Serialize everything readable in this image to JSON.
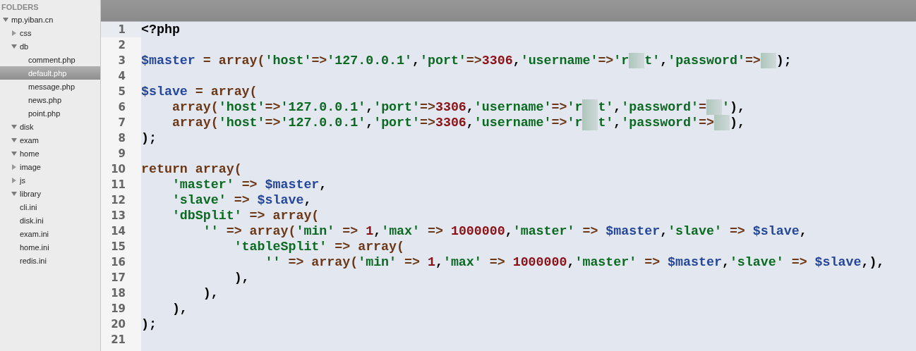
{
  "sidebar": {
    "header": "FOLDERS",
    "tree": [
      {
        "name": "mp.yiban.cn",
        "kind": "folder",
        "expanded": true,
        "selected": false,
        "children": [
          {
            "name": "css",
            "kind": "folder",
            "expanded": false,
            "selected": false
          },
          {
            "name": "db",
            "kind": "folder",
            "expanded": true,
            "selected": false,
            "children": [
              {
                "name": "comment.php",
                "kind": "file",
                "selected": false
              },
              {
                "name": "default.php",
                "kind": "file",
                "selected": true
              },
              {
                "name": "message.php",
                "kind": "file",
                "selected": false
              },
              {
                "name": "news.php",
                "kind": "file",
                "selected": false
              },
              {
                "name": "point.php",
                "kind": "file",
                "selected": false
              }
            ]
          },
          {
            "name": "disk",
            "kind": "folder",
            "expanded": true,
            "selected": false
          },
          {
            "name": "exam",
            "kind": "folder",
            "expanded": true,
            "selected": false
          },
          {
            "name": "home",
            "kind": "folder",
            "expanded": true,
            "selected": false
          },
          {
            "name": "image",
            "kind": "folder",
            "expanded": false,
            "selected": false
          },
          {
            "name": "js",
            "kind": "folder",
            "expanded": false,
            "selected": false
          },
          {
            "name": "library",
            "kind": "folder",
            "expanded": true,
            "selected": false
          },
          {
            "name": "cli.ini",
            "kind": "file",
            "selected": false
          },
          {
            "name": "disk.ini",
            "kind": "file",
            "selected": false
          },
          {
            "name": "exam.ini",
            "kind": "file",
            "selected": false
          },
          {
            "name": "home.ini",
            "kind": "file",
            "selected": false
          },
          {
            "name": "redis.ini",
            "kind": "file",
            "selected": false
          }
        ]
      }
    ]
  },
  "editor": {
    "lines": [
      {
        "number": "1",
        "current": true,
        "tokens": [
          {
            "kind": "t",
            "text": "<?php"
          }
        ]
      },
      {
        "number": "2",
        "current": false
      },
      {
        "number": "3",
        "current": false,
        "tokens": [
          {
            "kind": "v",
            "text": "$master"
          },
          {
            "kind": "k",
            "text": " = array("
          },
          {
            "kind": "s",
            "text": "'host'"
          },
          {
            "kind": "k",
            "text": "=>"
          },
          {
            "kind": "s",
            "text": "'127.0.0.1'"
          },
          {
            "kind": "p",
            "text": ","
          },
          {
            "kind": "s",
            "text": "'port'"
          },
          {
            "kind": "k",
            "text": "=>"
          },
          {
            "kind": "n",
            "text": "3306"
          },
          {
            "kind": "p",
            "text": ","
          },
          {
            "kind": "s",
            "text": "'username'"
          },
          {
            "kind": "k",
            "text": "=>"
          },
          {
            "kind": "s",
            "text": "'r"
          },
          {
            "kind": "r"
          },
          {
            "kind": "s",
            "text": "t'"
          },
          {
            "kind": "p",
            "text": ","
          },
          {
            "kind": "s",
            "text": "'password'"
          },
          {
            "kind": "k",
            "text": "=>"
          },
          {
            "kind": "r"
          },
          {
            "kind": "p",
            "text": ");"
          }
        ]
      },
      {
        "number": "4",
        "current": false
      },
      {
        "number": "5",
        "current": false,
        "tokens": [
          {
            "kind": "v",
            "text": "$slave"
          },
          {
            "kind": "k",
            "text": " = array("
          }
        ]
      },
      {
        "number": "6",
        "current": false,
        "tokens": [
          {
            "kind": "k",
            "text": "    array("
          },
          {
            "kind": "s",
            "text": "'host'"
          },
          {
            "kind": "k",
            "text": "=>"
          },
          {
            "kind": "s",
            "text": "'127.0.0.1'"
          },
          {
            "kind": "p",
            "text": ","
          },
          {
            "kind": "s",
            "text": "'port'"
          },
          {
            "kind": "k",
            "text": "=>"
          },
          {
            "kind": "n",
            "text": "3306"
          },
          {
            "kind": "p",
            "text": ","
          },
          {
            "kind": "s",
            "text": "'username'"
          },
          {
            "kind": "k",
            "text": "=>"
          },
          {
            "kind": "s",
            "text": "'r"
          },
          {
            "kind": "r"
          },
          {
            "kind": "s",
            "text": "t'"
          },
          {
            "kind": "p",
            "text": ","
          },
          {
            "kind": "s",
            "text": "'password'"
          },
          {
            "kind": "k",
            "text": "="
          },
          {
            "kind": "r"
          },
          {
            "kind": "s",
            "text": "'"
          },
          {
            "kind": "p",
            "text": "),"
          }
        ]
      },
      {
        "number": "7",
        "current": false,
        "tokens": [
          {
            "kind": "k",
            "text": "    array("
          },
          {
            "kind": "s",
            "text": "'host'"
          },
          {
            "kind": "k",
            "text": "=>"
          },
          {
            "kind": "s",
            "text": "'127.0.0.1'"
          },
          {
            "kind": "p",
            "text": ","
          },
          {
            "kind": "s",
            "text": "'port'"
          },
          {
            "kind": "k",
            "text": "=>"
          },
          {
            "kind": "n",
            "text": "3306"
          },
          {
            "kind": "p",
            "text": ","
          },
          {
            "kind": "s",
            "text": "'username'"
          },
          {
            "kind": "k",
            "text": "=>"
          },
          {
            "kind": "s",
            "text": "'r"
          },
          {
            "kind": "r"
          },
          {
            "kind": "s",
            "text": "t'"
          },
          {
            "kind": "p",
            "text": ","
          },
          {
            "kind": "s",
            "text": "'password'"
          },
          {
            "kind": "k",
            "text": "=>"
          },
          {
            "kind": "r"
          },
          {
            "kind": "p",
            "text": "),"
          }
        ]
      },
      {
        "number": "8",
        "current": false,
        "tokens": [
          {
            "kind": "p",
            "text": ");"
          }
        ]
      },
      {
        "number": "9",
        "current": false
      },
      {
        "number": "10",
        "current": false,
        "tokens": [
          {
            "kind": "k",
            "text": "return array("
          }
        ]
      },
      {
        "number": "11",
        "current": false,
        "tokens": [
          {
            "kind": "s",
            "text": "    'master'"
          },
          {
            "kind": "k",
            "text": " => "
          },
          {
            "kind": "v",
            "text": "$master"
          },
          {
            "kind": "p",
            "text": ","
          }
        ]
      },
      {
        "number": "12",
        "current": false,
        "tokens": [
          {
            "kind": "s",
            "text": "    'slave'"
          },
          {
            "kind": "k",
            "text": " => "
          },
          {
            "kind": "v",
            "text": "$slave"
          },
          {
            "kind": "p",
            "text": ","
          }
        ]
      },
      {
        "number": "13",
        "current": false,
        "tokens": [
          {
            "kind": "s",
            "text": "    'dbSplit'"
          },
          {
            "kind": "k",
            "text": " => array("
          }
        ]
      },
      {
        "number": "14",
        "current": false,
        "tokens": [
          {
            "kind": "s",
            "text": "        ''"
          },
          {
            "kind": "k",
            "text": " => array("
          },
          {
            "kind": "s",
            "text": "'min'"
          },
          {
            "kind": "k",
            "text": " => "
          },
          {
            "kind": "n",
            "text": "1"
          },
          {
            "kind": "p",
            "text": ","
          },
          {
            "kind": "s",
            "text": "'max'"
          },
          {
            "kind": "k",
            "text": " => "
          },
          {
            "kind": "n",
            "text": "1000000"
          },
          {
            "kind": "p",
            "text": ","
          },
          {
            "kind": "s",
            "text": "'master'"
          },
          {
            "kind": "k",
            "text": " => "
          },
          {
            "kind": "v",
            "text": "$master"
          },
          {
            "kind": "p",
            "text": ","
          },
          {
            "kind": "s",
            "text": "'slave'"
          },
          {
            "kind": "k",
            "text": " => "
          },
          {
            "kind": "v",
            "text": "$slave"
          },
          {
            "kind": "p",
            "text": ","
          }
        ]
      },
      {
        "number": "15",
        "current": false,
        "tokens": [
          {
            "kind": "s",
            "text": "            'tableSplit'"
          },
          {
            "kind": "k",
            "text": " => array("
          }
        ]
      },
      {
        "number": "16",
        "current": false,
        "tokens": [
          {
            "kind": "s",
            "text": "                ''"
          },
          {
            "kind": "k",
            "text": " => array("
          },
          {
            "kind": "s",
            "text": "'min'"
          },
          {
            "kind": "k",
            "text": " => "
          },
          {
            "kind": "n",
            "text": "1"
          },
          {
            "kind": "p",
            "text": ","
          },
          {
            "kind": "s",
            "text": "'max'"
          },
          {
            "kind": "k",
            "text": " => "
          },
          {
            "kind": "n",
            "text": "1000000"
          },
          {
            "kind": "p",
            "text": ","
          },
          {
            "kind": "s",
            "text": "'master'"
          },
          {
            "kind": "k",
            "text": " => "
          },
          {
            "kind": "v",
            "text": "$master"
          },
          {
            "kind": "p",
            "text": ","
          },
          {
            "kind": "s",
            "text": "'slave'"
          },
          {
            "kind": "k",
            "text": " => "
          },
          {
            "kind": "v",
            "text": "$slave"
          },
          {
            "kind": "p",
            "text": ",),"
          }
        ]
      },
      {
        "number": "17",
        "current": false,
        "tokens": [
          {
            "kind": "p",
            "text": "            ),"
          }
        ]
      },
      {
        "number": "18",
        "current": false,
        "tokens": [
          {
            "kind": "p",
            "text": "        ),"
          }
        ]
      },
      {
        "number": "19",
        "current": false,
        "tokens": [
          {
            "kind": "p",
            "text": "    ),"
          }
        ]
      },
      {
        "number": "20",
        "current": false,
        "tokens": [
          {
            "kind": "p",
            "text": ");"
          }
        ]
      },
      {
        "number": "21",
        "current": false
      }
    ]
  }
}
